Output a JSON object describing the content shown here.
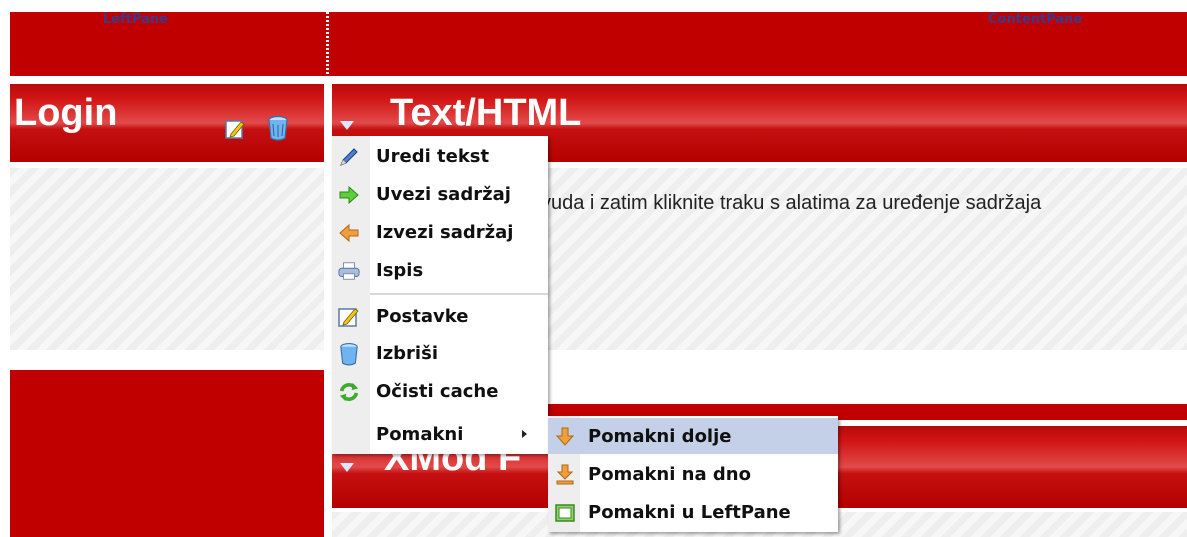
{
  "panes": {
    "left_label": "LeftPane",
    "content_label": "ContentPane"
  },
  "left_module": {
    "title": "Login",
    "icons": [
      "edit-icon",
      "delete-icon"
    ]
  },
  "content_module": {
    "title": "Text/HTML",
    "body_text": "vuda i zatim kliknite traku s alatima za uređenje sadržaja"
  },
  "second_module": {
    "title": "XMod F"
  },
  "context_menu": {
    "items": [
      {
        "label": "Uredi tekst",
        "icon": "pencil-icon"
      },
      {
        "label": "Uvezi sadržaj",
        "icon": "arrow-right-icon"
      },
      {
        "label": "Izvezi sadržaj",
        "icon": "arrow-left-icon"
      },
      {
        "label": "Ispis",
        "icon": "printer-icon"
      },
      {
        "label": "Postavke",
        "icon": "settings-icon"
      },
      {
        "label": "Izbriši",
        "icon": "delete-icon"
      },
      {
        "label": "Očisti cache",
        "icon": "refresh-icon"
      },
      {
        "label": "Pomakni",
        "icon": "submenu-arrow-icon"
      }
    ]
  },
  "submenu": {
    "items": [
      {
        "label": "Pomakni dolje",
        "icon": "move-down-icon",
        "highlighted": true
      },
      {
        "label": "Pomakni na dno",
        "icon": "move-bottom-icon"
      },
      {
        "label": "Pomakni u LeftPane",
        "icon": "move-pane-icon"
      }
    ]
  },
  "colors": {
    "header_red": "#c00000",
    "title_text": "#ffffff",
    "menu_highlight": "#c4cfe8",
    "pane_label": "#3a3a8a"
  }
}
